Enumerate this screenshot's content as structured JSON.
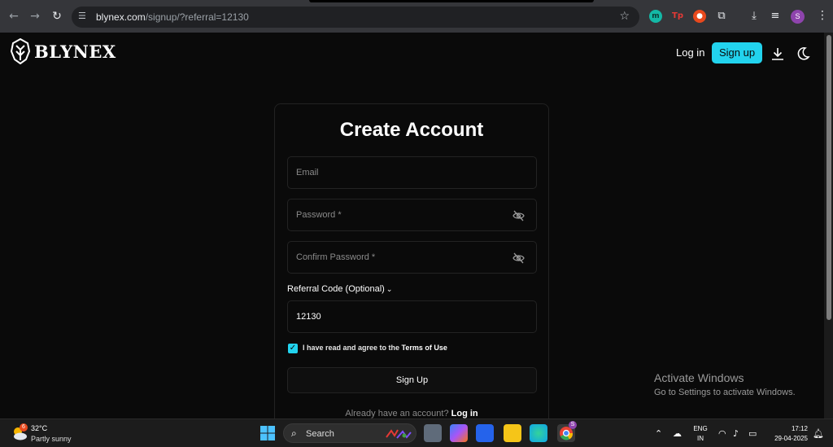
{
  "browser": {
    "url_host": "blynex.com",
    "url_path": "/signup/?referral=12130",
    "profile_initial": "S"
  },
  "site": {
    "brand": "BLYNEX",
    "nav": {
      "login_label": "Log in",
      "signup_label": "Sign up"
    },
    "accent_color": "#22d3ee"
  },
  "form": {
    "title": "Create Account",
    "email_placeholder": "Email",
    "password_placeholder": "Password *",
    "confirm_placeholder": "Confirm Password *",
    "referral_label": "Referral Code (Optional)",
    "referral_value": "12130",
    "agree_text": "I have read and agree to the ",
    "terms_text": "Terms of Use",
    "agree_checked": true,
    "submit_label": "Sign Up",
    "already_text": "Already have an account?",
    "login_text": "Log in"
  },
  "watermark": {
    "title": "Activate Windows",
    "subtitle": "Go to Settings to activate Windows."
  },
  "taskbar": {
    "weather_badge": "6",
    "temperature": "32°C",
    "condition": "Partly sunny",
    "search_label": "Search",
    "language": "ENG",
    "region": "IN",
    "time": "17:12",
    "date": "29-04-2025",
    "chrome_badge": "S"
  }
}
